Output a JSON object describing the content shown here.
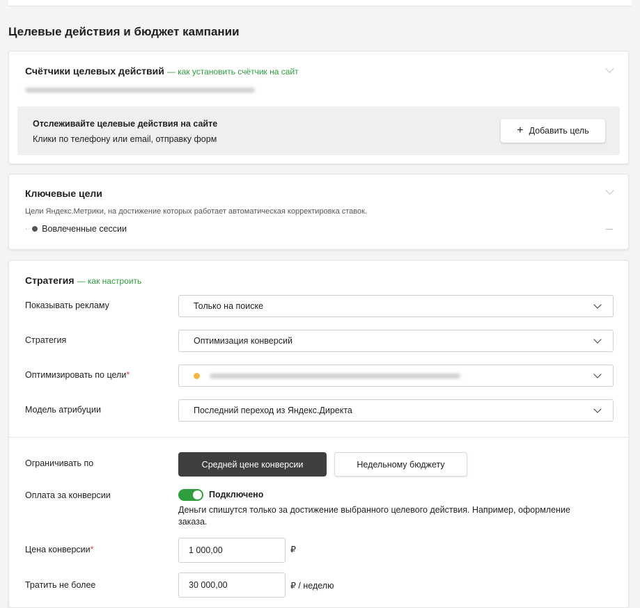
{
  "page": {
    "title": "Целевые действия и бюджет кампании"
  },
  "counters": {
    "title": "Счётчики целевых действий",
    "link": "— как установить счётчик на сайт",
    "tracking": {
      "title": "Отслеживайте целевые действия на сайте",
      "subtitle": "Клики по телефону или email, отправку форм",
      "add_button": "Добавить цель",
      "add_icon": "+"
    }
  },
  "key_goals": {
    "title": "Ключевые цели",
    "description": "Цели Яндекс.Метрики, на достижение которых работает автоматическая корректировка ставок.",
    "prefix": "·",
    "items": [
      "Вовлеченные сессии"
    ]
  },
  "strategy": {
    "title": "Стратегия",
    "link": "— как настроить",
    "rows": {
      "show_ads": {
        "label": "Показывать рекламу",
        "value": "Только на поиске"
      },
      "strategy": {
        "label": "Стратегия",
        "value": "Оптимизация конверсий"
      },
      "optimize_goal": {
        "label": "Оптимизировать по цели",
        "required_mark": "*"
      },
      "attribution": {
        "label": "Модель атрибуции",
        "value": "Последний переход из Яндекс.Директа"
      }
    },
    "limit": {
      "label": "Ограничивать по",
      "options": [
        "Средней цене конверсии",
        "Недельному бюджету"
      ],
      "selected": "Средней цене конверсии"
    },
    "pay_for_conversions": {
      "label": "Оплата за конверсии",
      "status": "Подключено",
      "enabled": true,
      "description": "Деньги спишутся только за достижение выбранного целевого действия. Например, оформление заказа."
    },
    "conversion_price": {
      "label": "Цена конверсии",
      "required_mark": "*",
      "value": "1 000,00",
      "unit": "₽"
    },
    "spend_limit": {
      "label": "Тратить не более",
      "value": "30 000,00",
      "unit": "₽ / неделю"
    }
  },
  "colors": {
    "accent_green": "#2e9e3e",
    "required_red": "#e04444",
    "goal_dot_orange": "#f7b543",
    "active_segment": "#3f3f3f"
  }
}
